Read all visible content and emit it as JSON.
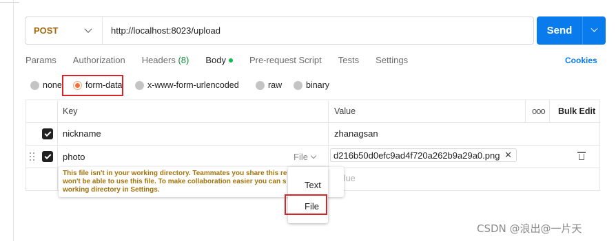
{
  "request": {
    "method": "POST",
    "url": "http://localhost:8023/upload",
    "send_label": "Send"
  },
  "tabs": [
    {
      "label": "Params"
    },
    {
      "label": "Authorization"
    },
    {
      "label": "Headers",
      "count": "(8)"
    },
    {
      "label": "Body",
      "active": true
    },
    {
      "label": "Pre-request Script"
    },
    {
      "label": "Tests"
    },
    {
      "label": "Settings"
    }
  ],
  "cookies_label": "Cookies",
  "body_types": [
    {
      "label": "none",
      "selected": false
    },
    {
      "label": "form-data",
      "selected": true
    },
    {
      "label": "x-www-form-urlencoded",
      "selected": false
    },
    {
      "label": "raw",
      "selected": false
    },
    {
      "label": "binary",
      "selected": false
    }
  ],
  "table": {
    "headers": {
      "key": "Key",
      "value": "Value",
      "more": "ooo",
      "bulk_edit": "Bulk Edit"
    },
    "rows": [
      {
        "checked": true,
        "key": "nickname",
        "value": "zhanagsan"
      },
      {
        "checked": true,
        "key": "photo",
        "type": "File",
        "value": "d216b50d0efc9ad4f720a262b9a29a0.png"
      }
    ],
    "new_value_placeholder": "lue"
  },
  "warning": {
    "line1": "This file isn't in your working directory. Teammates you share this re",
    "line2": "won't be able to use this file. To make collaboration easier you can s",
    "line3": "working directory in Settings."
  },
  "type_menu": {
    "options": [
      "Text",
      "File"
    ]
  },
  "watermark": "CSDN @浪出@一片天",
  "colors": {
    "accent": "#097bed",
    "method": "#a66a0e",
    "radio_selected": "#ff6c37",
    "highlight": "#d8232a",
    "warning": "#a5730b"
  }
}
